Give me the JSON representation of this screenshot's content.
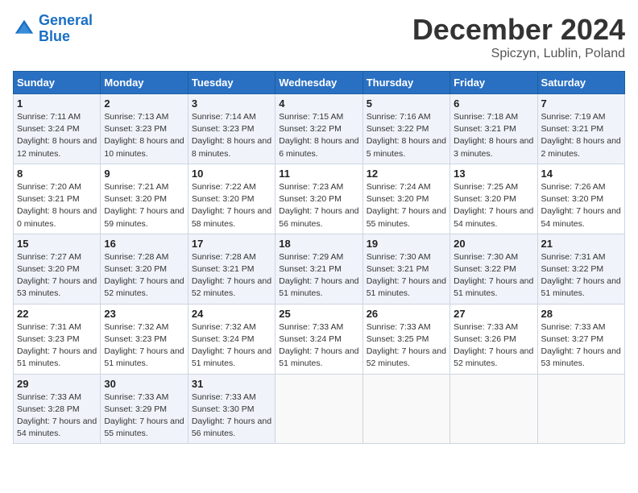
{
  "header": {
    "logo_line1": "General",
    "logo_line2": "Blue",
    "month": "December 2024",
    "location": "Spiczyn, Lublin, Poland"
  },
  "weekdays": [
    "Sunday",
    "Monday",
    "Tuesday",
    "Wednesday",
    "Thursday",
    "Friday",
    "Saturday"
  ],
  "weeks": [
    [
      {
        "day": "1",
        "sunrise": "7:11 AM",
        "sunset": "3:24 PM",
        "daylight": "8 hours and 12 minutes."
      },
      {
        "day": "2",
        "sunrise": "7:13 AM",
        "sunset": "3:23 PM",
        "daylight": "8 hours and 10 minutes."
      },
      {
        "day": "3",
        "sunrise": "7:14 AM",
        "sunset": "3:23 PM",
        "daylight": "8 hours and 8 minutes."
      },
      {
        "day": "4",
        "sunrise": "7:15 AM",
        "sunset": "3:22 PM",
        "daylight": "8 hours and 6 minutes."
      },
      {
        "day": "5",
        "sunrise": "7:16 AM",
        "sunset": "3:22 PM",
        "daylight": "8 hours and 5 minutes."
      },
      {
        "day": "6",
        "sunrise": "7:18 AM",
        "sunset": "3:21 PM",
        "daylight": "8 hours and 3 minutes."
      },
      {
        "day": "7",
        "sunrise": "7:19 AM",
        "sunset": "3:21 PM",
        "daylight": "8 hours and 2 minutes."
      }
    ],
    [
      {
        "day": "8",
        "sunrise": "7:20 AM",
        "sunset": "3:21 PM",
        "daylight": "8 hours and 0 minutes."
      },
      {
        "day": "9",
        "sunrise": "7:21 AM",
        "sunset": "3:20 PM",
        "daylight": "7 hours and 59 minutes."
      },
      {
        "day": "10",
        "sunrise": "7:22 AM",
        "sunset": "3:20 PM",
        "daylight": "7 hours and 58 minutes."
      },
      {
        "day": "11",
        "sunrise": "7:23 AM",
        "sunset": "3:20 PM",
        "daylight": "7 hours and 56 minutes."
      },
      {
        "day": "12",
        "sunrise": "7:24 AM",
        "sunset": "3:20 PM",
        "daylight": "7 hours and 55 minutes."
      },
      {
        "day": "13",
        "sunrise": "7:25 AM",
        "sunset": "3:20 PM",
        "daylight": "7 hours and 54 minutes."
      },
      {
        "day": "14",
        "sunrise": "7:26 AM",
        "sunset": "3:20 PM",
        "daylight": "7 hours and 54 minutes."
      }
    ],
    [
      {
        "day": "15",
        "sunrise": "7:27 AM",
        "sunset": "3:20 PM",
        "daylight": "7 hours and 53 minutes."
      },
      {
        "day": "16",
        "sunrise": "7:28 AM",
        "sunset": "3:20 PM",
        "daylight": "7 hours and 52 minutes."
      },
      {
        "day": "17",
        "sunrise": "7:28 AM",
        "sunset": "3:21 PM",
        "daylight": "7 hours and 52 minutes."
      },
      {
        "day": "18",
        "sunrise": "7:29 AM",
        "sunset": "3:21 PM",
        "daylight": "7 hours and 51 minutes."
      },
      {
        "day": "19",
        "sunrise": "7:30 AM",
        "sunset": "3:21 PM",
        "daylight": "7 hours and 51 minutes."
      },
      {
        "day": "20",
        "sunrise": "7:30 AM",
        "sunset": "3:22 PM",
        "daylight": "7 hours and 51 minutes."
      },
      {
        "day": "21",
        "sunrise": "7:31 AM",
        "sunset": "3:22 PM",
        "daylight": "7 hours and 51 minutes."
      }
    ],
    [
      {
        "day": "22",
        "sunrise": "7:31 AM",
        "sunset": "3:23 PM",
        "daylight": "7 hours and 51 minutes."
      },
      {
        "day": "23",
        "sunrise": "7:32 AM",
        "sunset": "3:23 PM",
        "daylight": "7 hours and 51 minutes."
      },
      {
        "day": "24",
        "sunrise": "7:32 AM",
        "sunset": "3:24 PM",
        "daylight": "7 hours and 51 minutes."
      },
      {
        "day": "25",
        "sunrise": "7:33 AM",
        "sunset": "3:24 PM",
        "daylight": "7 hours and 51 minutes."
      },
      {
        "day": "26",
        "sunrise": "7:33 AM",
        "sunset": "3:25 PM",
        "daylight": "7 hours and 52 minutes."
      },
      {
        "day": "27",
        "sunrise": "7:33 AM",
        "sunset": "3:26 PM",
        "daylight": "7 hours and 52 minutes."
      },
      {
        "day": "28",
        "sunrise": "7:33 AM",
        "sunset": "3:27 PM",
        "daylight": "7 hours and 53 minutes."
      }
    ],
    [
      {
        "day": "29",
        "sunrise": "7:33 AM",
        "sunset": "3:28 PM",
        "daylight": "7 hours and 54 minutes."
      },
      {
        "day": "30",
        "sunrise": "7:33 AM",
        "sunset": "3:29 PM",
        "daylight": "7 hours and 55 minutes."
      },
      {
        "day": "31",
        "sunrise": "7:33 AM",
        "sunset": "3:30 PM",
        "daylight": "7 hours and 56 minutes."
      },
      null,
      null,
      null,
      null
    ]
  ]
}
